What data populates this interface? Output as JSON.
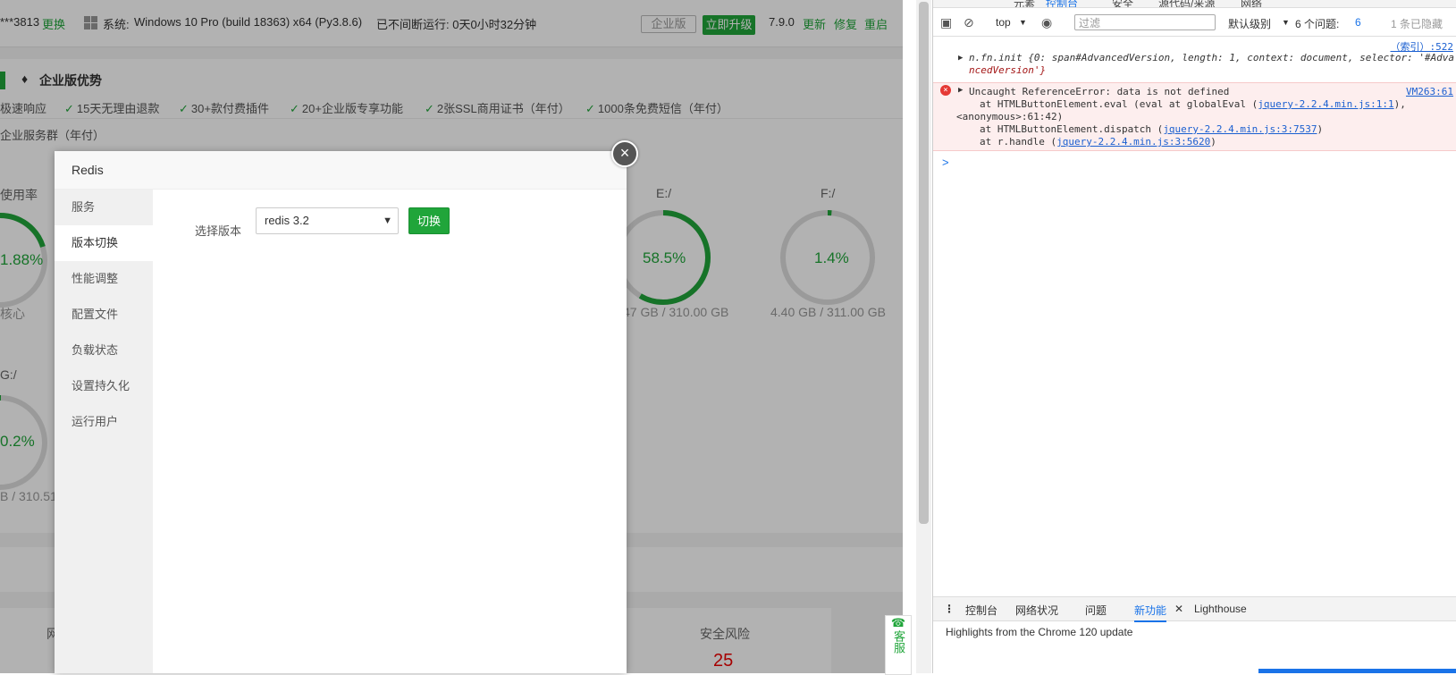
{
  "topbar": {
    "ip_text": "***3813",
    "change_link": "更换",
    "system_label": "系统:",
    "system_value": "Windows 10 Pro (build 18363) x64 (Py3.8.6)",
    "uptime": "已不间断运行: 0天0小时32分钟",
    "enterprise_badge": "企业版",
    "upgrade_button": "立即升级",
    "version": "7.9.0",
    "update": "更新",
    "repair": "修复",
    "restart": "重启"
  },
  "promo": {
    "title": "企业版优势",
    "features": [
      "极速响应",
      "15天无理由退款",
      "30+款付费插件",
      "20+企业版专享功能",
      "2张SSL商用证书（年付）",
      "1000条免费短信（年付）"
    ],
    "group_text": "企业服务群（年付）"
  },
  "gauges": [
    {
      "label": "使用率",
      "value": "1.88%",
      "sub": "核心"
    },
    {
      "label": "E:/",
      "value": "58.5%",
      "sub": "47 GB / 310.00 GB"
    },
    {
      "label": "F:/",
      "value": "1.4%",
      "sub": "4.40 GB / 311.00 GB"
    },
    {
      "label": "G:/",
      "value": "0.2%",
      "sub": "B / 310.51"
    }
  ],
  "bottom": {
    "left_label": "网",
    "risk_label": "安全风险",
    "risk_value": "25"
  },
  "kefu": "客服",
  "modal": {
    "title": "Redis",
    "close": "×",
    "menu": [
      "服务",
      "版本切换",
      "性能调整",
      "配置文件",
      "负载状态",
      "设置持久化",
      "运行用户"
    ],
    "active_index": 1,
    "version_label": "选择版本",
    "version_selected": "redis 3.2",
    "switch_button": "切换"
  },
  "devtools": {
    "tabs_partial": [
      "元素",
      "控制台",
      "安全",
      "源代码/来源",
      "网络"
    ],
    "context": "top",
    "filter_placeholder": "过滤",
    "level": "默认级别",
    "issues": "6 个问题:",
    "issues_count": "6",
    "hidden": "1 条已隐藏",
    "log1_source": "（索引）:522",
    "log1_text": "n.fn.init {0: span#AdvancedVersion, length: 1, context: document, selector: '#Adva",
    "log1_text2": "ncedVersion'}",
    "err_source": "VM263:61",
    "err_line1": "Uncaught ReferenceError: data is not defined",
    "err_line2_pre": "at HTMLButtonElement.eval (eval at globalEval (",
    "err_line2_link": "jquery-2.2.4.min.js:1:1",
    "err_line2_post": "),",
    "err_line3": "<anonymous>:61:42)",
    "err_line4_pre": "at HTMLButtonElement.dispatch (",
    "err_line4_link": "jquery-2.2.4.min.js:3:7537",
    "err_line5_pre": "at r.handle (",
    "err_line5_link": "jquery-2.2.4.min.js:3:5620",
    "prompt": ">",
    "drawer_tabs": [
      "控制台",
      "网络状况",
      "问题",
      "新功能",
      "Lighthouse"
    ],
    "whatsnew_text": "Highlights from the Chrome 120 update"
  },
  "colors": {
    "accent": "#20a53a",
    "error_bg": "#fdeeee",
    "link": "#1a5fd0"
  }
}
